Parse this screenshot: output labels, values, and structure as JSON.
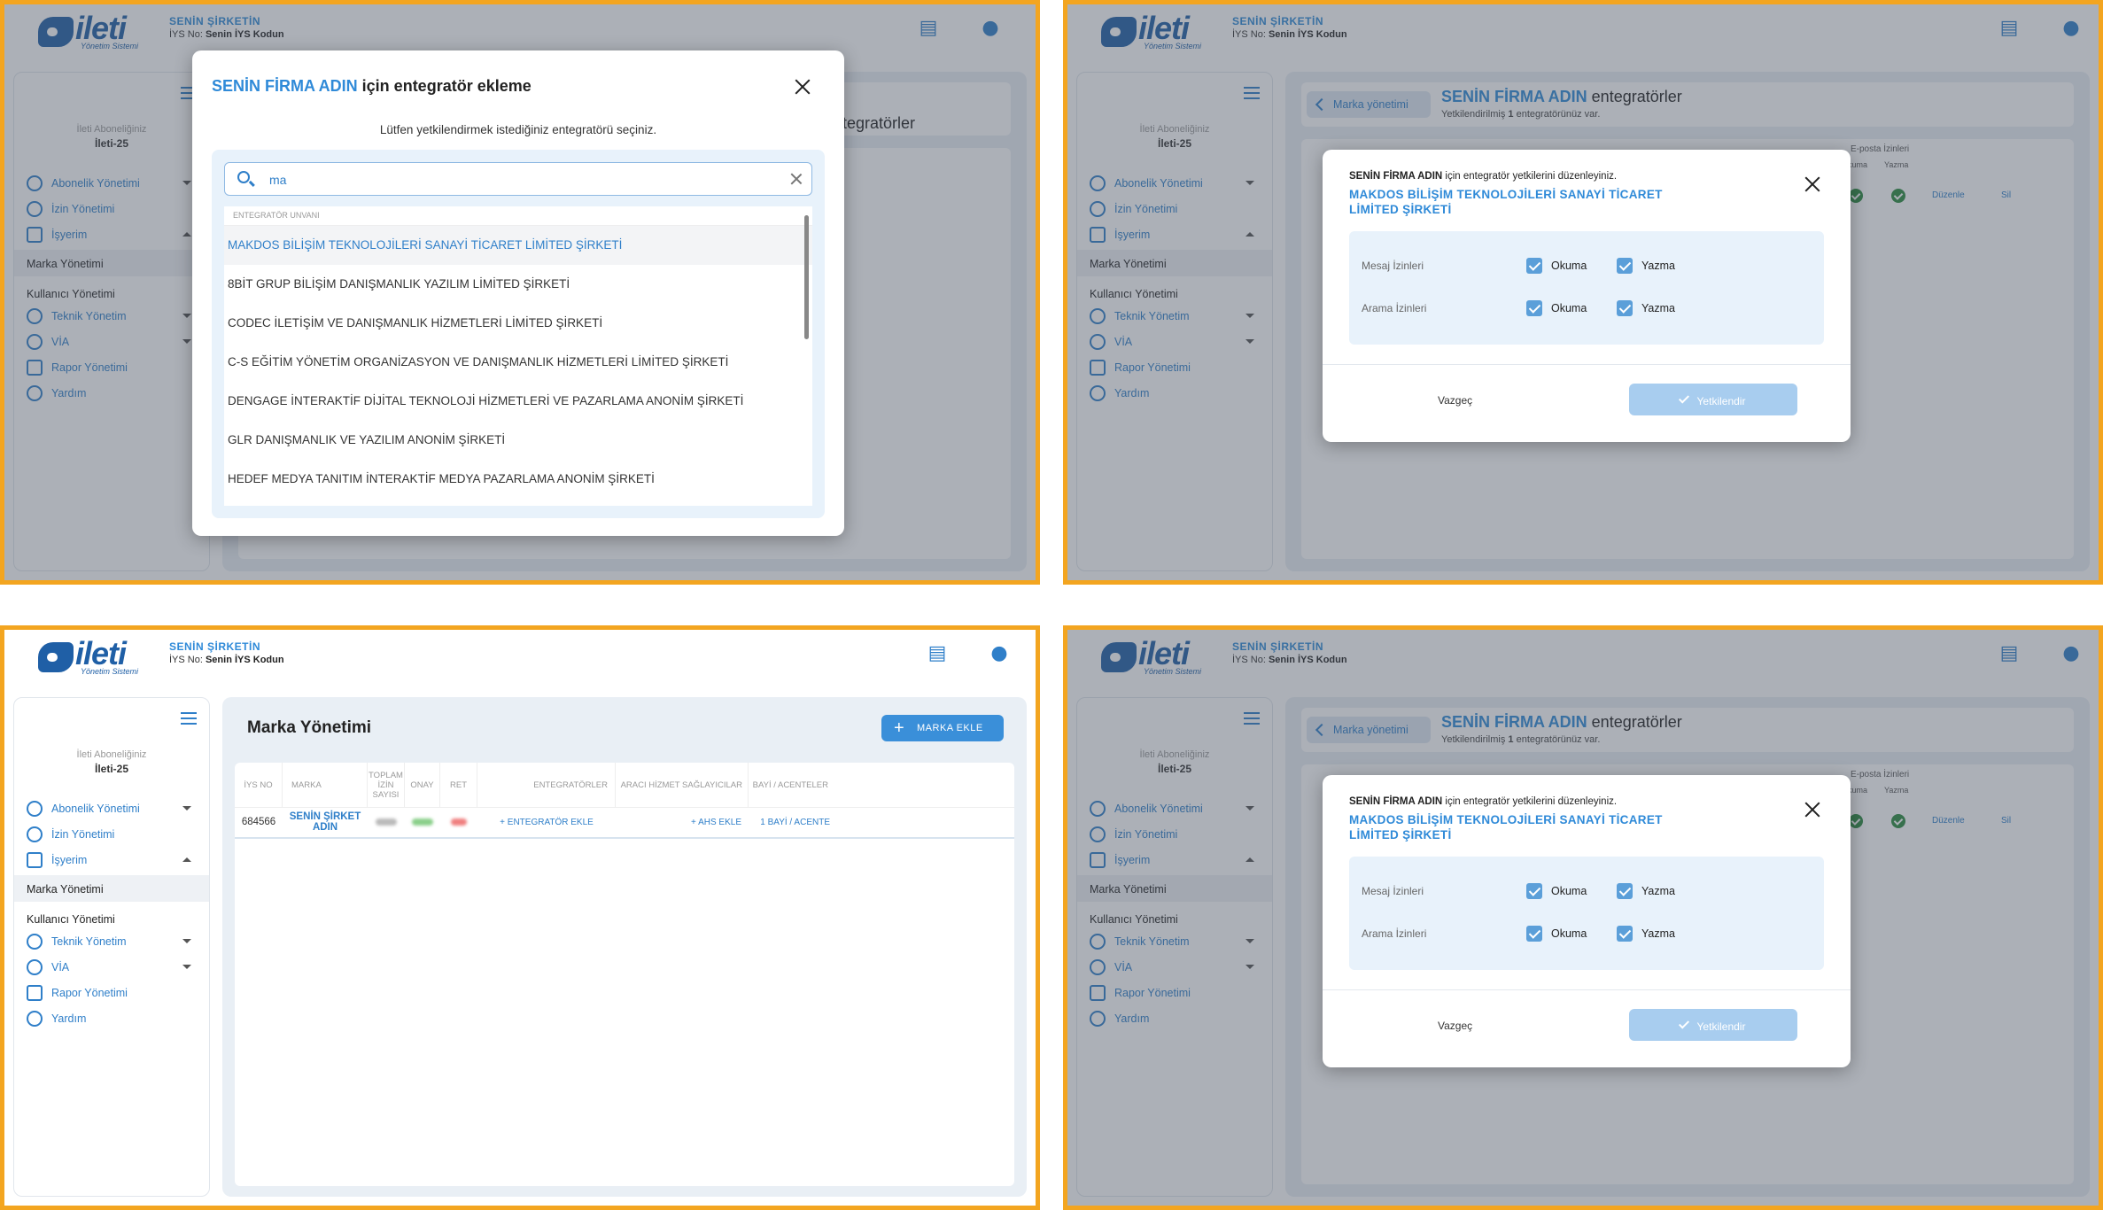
{
  "header": {
    "company_name": "SENİN ŞİRKETİN",
    "iys_label": "İYS No:",
    "iys_value": "Senin İYS Kodun",
    "logo_text": "ileti",
    "logo_sub": "Yönetim Sistemi"
  },
  "sidebar": {
    "subscription_label": "İleti Aboneliğiniz",
    "subscription_value": "İleti-25",
    "items": [
      {
        "label": "Abonelik Yönetimi"
      },
      {
        "label": "İzin Yönetimi"
      },
      {
        "label": "İşyerim"
      },
      {
        "label": "Marka Yönetimi"
      },
      {
        "label": "Kullanıcı Yönetimi"
      },
      {
        "label": "Teknik Yönetim"
      },
      {
        "label": "VİA"
      },
      {
        "label": "Rapor Yönetimi"
      },
      {
        "label": "Yardım"
      }
    ]
  },
  "modal_add": {
    "brand": "SENİN FİRMA ADIN",
    "title_suffix": " için entegratör ekleme",
    "description": "Lütfen yetkilendirmek istediğiniz entegratörü seçiniz.",
    "search_value": "ma",
    "list_header": "ENTEGRATÖR UNVANI",
    "options": [
      "MAKDOS BİLİŞİM TEKNOLOJİLERİ SANAYİ TİCARET LİMİTED ŞİRKETİ",
      "8BİT GRUP BİLİŞİM DANIŞMANLIK YAZILIM LİMİTED ŞİRKETİ",
      "CODEC İLETİŞİM VE DANIŞMANLIK HİZMETLERİ LİMİTED ŞİRKETİ",
      "C-S EĞİTİM YÖNETİM ORGANİZASYON VE DANIŞMANLIK HİZMETLERİ LİMİTED ŞİRKETİ",
      "DENGAGE İNTERAKTİF DİJİTAL TEKNOLOJİ HİZMETLERİ VE PAZARLAMA ANONİM ŞİRKETİ",
      "GLR DANIŞMANLIK VE YAZILIM ANONİM ŞİRKETİ",
      "HEDEF MEDYA TANITIM İNTERAKTİF MEDYA PAZARLAMA ANONİM ŞİRKETİ"
    ],
    "bg_title_fragment": "ntegratörler"
  },
  "integrators_page": {
    "back_label": "Marka yönetimi",
    "brand": "SENİN FİRMA ADIN",
    "title_suffix": " entegratörler",
    "subtitle_prefix": "Yetkilendirilmiş ",
    "subtitle_count": "1",
    "subtitle_suffix": " entegratörünüz var.",
    "email_perm_header": "E-posta İzinleri",
    "read_col": "Okuma",
    "write_col": "Yazma",
    "edit_label": "Düzenle",
    "delete_label": "Sil"
  },
  "modal_perm": {
    "intro_brand": "SENİN FİRMA ADIN",
    "intro_suffix": " için entegratör yetkilerini düzenleyiniz.",
    "integrator_name": "MAKDOS BİLİŞİM TEKNOLOJİLERİ SANAYİ TİCARET LİMİTED ŞİRKETİ",
    "rows": [
      {
        "label": "Mesaj İzinleri",
        "read": "Okuma",
        "write": "Yazma"
      },
      {
        "label": "Arama İzinleri",
        "read": "Okuma",
        "write": "Yazma"
      }
    ],
    "cancel_label": "Vazgeç",
    "ok_label": "Yetkilendir"
  },
  "brand_page": {
    "title": "Marka Yönetimi",
    "add_button": "MARKA EKLE",
    "columns": [
      "İYS NO",
      "MARKA",
      "TOPLAM İZİN SAYISI",
      "ONAY",
      "RET",
      "ENTEGRATÖRLER",
      "ARACI HİZMET SAĞLAYICILAR",
      "BAYİ / ACENTELER"
    ],
    "row": {
      "iys_no": "684566",
      "brand": "SENİN ŞİRKET ADIN",
      "integrators": "+ ENTEGRATÖR EKLE",
      "ahs": "+ AHS EKLE",
      "dealers": "1 BAYİ / ACENTE"
    }
  },
  "colors": {
    "accent": "#2f8ad8",
    "frame": "#f3a520",
    "sidebar_icon": "#2f7fc9"
  }
}
